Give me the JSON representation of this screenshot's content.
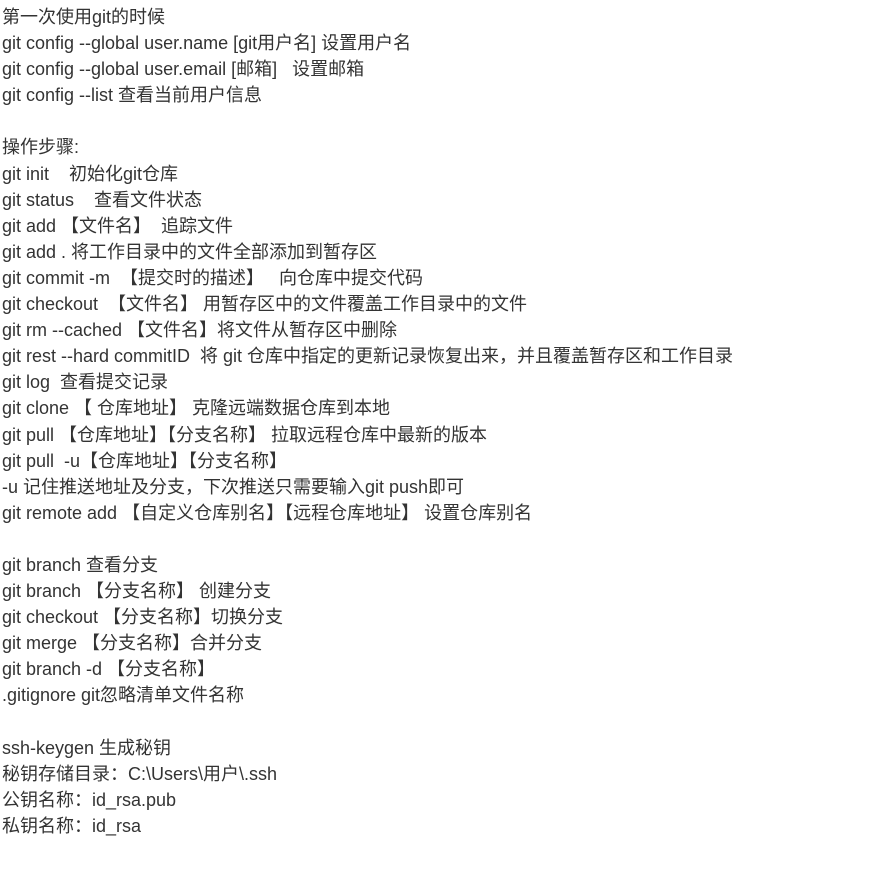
{
  "lines": [
    "第一次使用git的时候",
    "git config --global user.name [git用户名] 设置用户名",
    "git config --global user.email [邮箱]   设置邮箱",
    "git config --list 查看当前用户信息",
    "",
    "操作步骤:",
    "git init    初始化git仓库",
    "git status    查看文件状态",
    "git add 【文件名】  追踪文件",
    "git add . 将工作目录中的文件全部添加到暂存区",
    "git commit -m  【提交时的描述】   向仓库中提交代码",
    "git checkout  【文件名】 用暂存区中的文件覆盖工作目录中的文件",
    "git rm --cached 【文件名】将文件从暂存区中删除",
    "git rest --hard commitID  将 git 仓库中指定的更新记录恢复出来，并且覆盖暂存区和工作目录",
    "git log  查看提交记录",
    "git clone 【 仓库地址】 克隆远端数据仓库到本地",
    "git pull 【仓库地址】【分支名称】 拉取远程仓库中最新的版本",
    "git pull  -u【仓库地址】【分支名称】",
    "-u 记住推送地址及分支，下次推送只需要输入git push即可",
    "git remote add 【自定义仓库别名】【远程仓库地址】 设置仓库别名",
    "",
    "git branch 查看分支",
    "git branch 【分支名称】 创建分支",
    "git checkout 【分支名称】切换分支",
    "git merge 【分支名称】合并分支",
    "git branch -d 【分支名称】",
    ".gitignore git忽略清单文件名称",
    "",
    "ssh-keygen 生成秘钥",
    "秘钥存储目录：C:\\Users\\用户\\.ssh",
    "公钥名称：id_rsa.pub",
    "私钥名称：id_rsa"
  ]
}
